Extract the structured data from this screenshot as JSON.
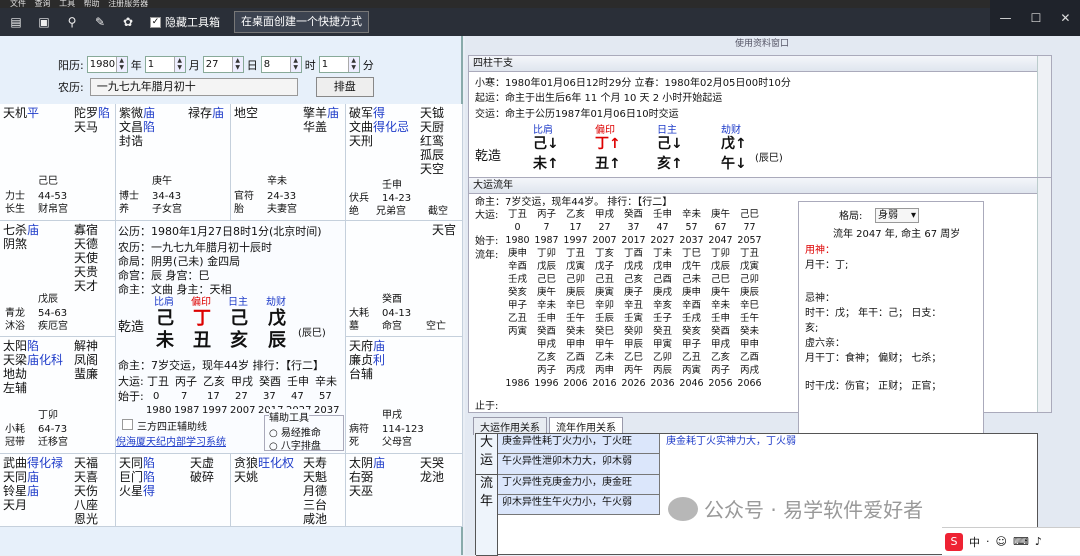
{
  "menubar": [
    "文件",
    "查询",
    "工具",
    "帮助",
    "注册服务器"
  ],
  "toolbar": {
    "checkbox_label": "隐藏工具箱",
    "shortcut_button": "在桌面创建一个快捷方式"
  },
  "date_form": {
    "solar_label": "阳历:",
    "year": "1980",
    "year_unit": "年",
    "month": "1",
    "month_unit": "月",
    "day": "27",
    "day_unit": "日",
    "hour": "8",
    "hour_unit": "时",
    "minute": "1",
    "minute_unit": "分",
    "lunar_label": "农历:",
    "lunar_value": "一九七九年腊月初十",
    "arrange_button": "排盘"
  },
  "palaces": {
    "p1": {
      "stars_a": "天机",
      "stars_a2": "平",
      "stars_b": "陀罗",
      "stars_b2": "陷",
      "stars_c": "天马",
      "ganzhi": "己巳",
      "ages": "44-53",
      "god1": "力士",
      "god2": "长生",
      "name": "财帛宫"
    },
    "p2": {
      "stars_a": "紫微",
      "stars_a2": "庙",
      "stars_b": "文昌",
      "stars_b2": "陷",
      "stars_c": "封诰",
      "side": "禄存",
      "side2": "庙",
      "ganzhi": "庚午",
      "ages": "34-43",
      "god1": "博士",
      "god2": "养",
      "name": "子女宫"
    },
    "p3": {
      "stars_a": "地空",
      "side": "擎羊",
      "side2": "庙",
      "side3": "华盖",
      "ganzhi": "辛未",
      "ages": "24-33",
      "god1": "官符",
      "god2": "胎",
      "name": "夫妻宫"
    },
    "p4": {
      "stars_a": "破军",
      "stars_a2": "得",
      "stars_b": "文曲",
      "stars_b2": "得化忌",
      "stars_c": "天刑",
      "col": "天钺",
      "col2": "天厨",
      "col3": "红鸾",
      "col4": "孤辰",
      "col5": "天空",
      "ganzhi": "壬申",
      "ages": "14-23",
      "god1": "伏兵",
      "god2": "绝",
      "name": "兄弟宫",
      "extra": "截空"
    },
    "p5": {
      "stars_a": "七杀",
      "stars_a2": "庙",
      "stars_b": "阴煞",
      "col": "寡宿",
      "col2": "天德",
      "col3": "天使",
      "col4": "天贵",
      "col5": "天才",
      "ganzhi": "戊辰",
      "ages": "54-63",
      "god1": "青龙",
      "god2": "沐浴",
      "name": "疾厄宫"
    },
    "p6": {
      "stars_a": "天官",
      "ganzhi": "癸酉",
      "ages": "04-13",
      "god1": "大耗",
      "god2": "墓",
      "name": "命宫",
      "extra": "空亡"
    },
    "p7": {
      "stars_a": "太阳",
      "stars_a2": "陷",
      "stars_b": "天梁",
      "stars_b2": "庙化科",
      "stars_c": "地劫",
      "stars_d": "左辅",
      "col": "解神",
      "col2": "凤阁",
      "col3": "蜚廉",
      "ganzhi": "丁卯",
      "ages": "64-73",
      "god1": "小耗",
      "god2": "冠带",
      "name": "迁移宫"
    },
    "p8": {
      "stars_a": "天府",
      "stars_a2": "庙",
      "stars_b": "廉贞",
      "stars_b2": "利",
      "stars_c": "台辅",
      "ganzhi": "甲戌",
      "ages": "114-123",
      "god1": "病符",
      "god2": "死",
      "name": "父母宫"
    },
    "p9": {
      "stars_a": "武曲",
      "stars_a2": "得化禄",
      "stars_b": "天同",
      "stars_b2": "庙",
      "stars_c": "铃星",
      "stars_c2": "庙",
      "stars_d": "天月",
      "col": "天福",
      "col2": "天喜",
      "col3": "天伤",
      "col4": "八座",
      "col5": "恩光"
    },
    "p10": {
      "stars_a": "天同",
      "stars_a2": "陷",
      "stars_b": "巨门",
      "stars_b2": "陷",
      "stars_c": "火星",
      "stars_c2": "得",
      "col": "天虚",
      "col2": "破碎"
    },
    "p11": {
      "stars_a": "贪狼",
      "stars_a2": "旺化权",
      "stars_b": "天姚",
      "col": "天寿",
      "col2": "天魁",
      "col3": "月德",
      "col4": "三台",
      "col5": "咸池"
    },
    "p12": {
      "stars_a": "太阴",
      "stars_a2": "庙",
      "stars_b": "右弼",
      "stars_c": "天巫",
      "col": "天哭",
      "col2": "龙池"
    }
  },
  "center": {
    "solar": "公历：1980年1月27日8时1分(北京时间)",
    "lunar": "农历：一九七九年腊月初十辰时",
    "mingju": "命局：阴男(己未)   金四局",
    "minggong": "命宫：辰   身宫：巳",
    "mingzhu": "命主：文曲 身主：天相",
    "ten_gods": [
      "比肩",
      "偏印",
      "日主",
      "劫财"
    ],
    "stems": [
      "己",
      "丁",
      "己",
      "戊"
    ],
    "branches": [
      "未",
      "丑",
      "亥",
      "辰"
    ],
    "qianzao": "乾造",
    "chensuffix": "(辰巳)",
    "luck_line": "命主：7岁交运，现年44岁   排行：【行二】",
    "dayun_label": "大运:",
    "dayun": [
      "丁丑",
      "丙子",
      "乙亥",
      "甲戌",
      "癸酉",
      "壬申",
      "辛未"
    ],
    "start_label": "始于:",
    "start_ages": [
      "0",
      "7",
      "17",
      "27",
      "37",
      "47",
      "57"
    ],
    "start_years": [
      "1980",
      "1987",
      "1997",
      "2007",
      "2017",
      "2027",
      "2037"
    ],
    "aux_title": "辅助工具",
    "aux_opt1": "易经推命",
    "aux_opt2": "八字排盘",
    "sanfang": "三方四正辅助线",
    "link": "倪海厦天纪内部学习系统"
  },
  "right": {
    "fullscreen_btn": "使用资料窗口",
    "sizhu_title": "四柱干支",
    "xiaohan": "小寒：1980年01月06日12时29分  立春：1980年02月05日00时10分",
    "qiyun": "起运：命主于出生后6年 11 个月 10 天 2 小时开始起运",
    "jiaoyun": "交运：命主于公历1987年01月06日10时交运",
    "ten_gods": [
      "比肩",
      "偏印",
      "日主",
      "劫财"
    ],
    "stems": [
      "己↓",
      "丁↑",
      "己↓",
      "戊↑"
    ],
    "branches": [
      "未↑",
      "丑↑",
      "亥↑",
      "午↓"
    ],
    "qianzao": "乾造",
    "suffix": "(辰巳)",
    "dayun_title": "大运流年",
    "mingzhu_line": "命主：7岁交运，现年44岁。  排行：【行二】",
    "dayun_label": "大运:",
    "dayun": [
      "丁丑",
      "丙子",
      "乙亥",
      "甲戌",
      "癸酉",
      "壬申",
      "辛未",
      "庚午",
      "己巳"
    ],
    "age_row": [
      "0",
      "7",
      "17",
      "27",
      "37",
      "47",
      "57",
      "67",
      "77"
    ],
    "start_label": "始于:",
    "start_years": [
      "1980",
      "1987",
      "1997",
      "2007",
      "2017",
      "2027",
      "2037",
      "2047",
      "2057"
    ],
    "liunian_label": "流年:",
    "liunian": [
      [
        "庚申",
        "丁卯",
        "丁丑",
        "丁亥",
        "丁酉",
        "丁未",
        "丁巳",
        "丁卯",
        "丁丑"
      ],
      [
        "辛酉",
        "戊辰",
        "戊寅",
        "戊子",
        "戊戌",
        "戊申",
        "戊午",
        "戊辰",
        "戊寅"
      ],
      [
        "壬戌",
        "己巳",
        "己卯",
        "己丑",
        "己亥",
        "己酉",
        "己未",
        "己巳",
        "己卯"
      ],
      [
        "癸亥",
        "庚午",
        "庚辰",
        "庚寅",
        "庚子",
        "庚戌",
        "庚申",
        "庚午",
        "庚辰"
      ],
      [
        "甲子",
        "辛未",
        "辛巳",
        "辛卯",
        "辛丑",
        "辛亥",
        "辛酉",
        "辛未",
        "辛巳"
      ],
      [
        "乙丑",
        "壬申",
        "壬午",
        "壬辰",
        "壬寅",
        "壬子",
        "壬戌",
        "壬申",
        "壬午"
      ],
      [
        "丙寅",
        "癸酉",
        "癸未",
        "癸巳",
        "癸卯",
        "癸丑",
        "癸亥",
        "癸酉",
        "癸未"
      ],
      [
        "",
        "甲戌",
        "甲申",
        "甲午",
        "甲辰",
        "甲寅",
        "甲子",
        "甲戌",
        "甲申"
      ],
      [
        "",
        "乙亥",
        "乙酉",
        "乙未",
        "乙巳",
        "乙卯",
        "乙丑",
        "乙亥",
        "乙酉"
      ],
      [
        "",
        "丙子",
        "丙戌",
        "丙申",
        "丙午",
        "丙辰",
        "丙寅",
        "丙子",
        "丙戌"
      ]
    ],
    "end_label": "止于:",
    "end_years": [
      "1986",
      "1996",
      "2006",
      "2016",
      "2026",
      "2036",
      "2046",
      "2056",
      "2066"
    ],
    "side": {
      "geju_label": "格局:",
      "geju_value": "身弱",
      "liunian": "流年 2047 年, 命主 67 周岁",
      "yongshen": "用神：",
      "yuegan": "月干：丁;",
      "jishen": "忌神：",
      "shigan": "时干：戊；  年干：己；  日支：",
      "hai": "亥;",
      "xulu": "虚六亲：",
      "yuegan2": "月干丁：食神；  偏财；  七杀；",
      "shigan2": "时干戊：伤官；  正财；  正官；"
    },
    "tab1": "大运作用关系",
    "tab2": "流年作用关系",
    "rel": {
      "g1": "大运",
      "g2": "流年",
      "r1": "庚金异性耗丁火力小，丁火旺",
      "r1b": "庚金耗丁火实神力大，丁火弱",
      "r2": "午火异性泄卯木力大，卯木弱",
      "r3": "丁火异性克庚金力小，庚金旺",
      "r4": "卯木异性生午火力小，午火弱"
    }
  },
  "watermark": "公众号 · 易学软件爱好者",
  "taskbar": [
    "中",
    "·",
    "☺",
    "⌨",
    "♪"
  ]
}
